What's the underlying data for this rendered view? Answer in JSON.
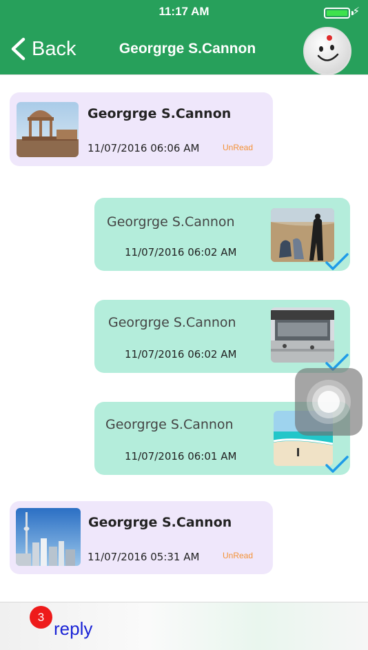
{
  "status_bar": {
    "time": "11:17 AM"
  },
  "nav": {
    "back_label": "Back",
    "title": "Georgrge S.Cannon"
  },
  "messages": [
    {
      "direction": "incoming",
      "sender": "Georgrge S.Cannon",
      "time": "11/07/2016 06:06 AM",
      "status": "UnRead",
      "thumbnail": "pavilion-photo"
    },
    {
      "direction": "outgoing",
      "sender": "Georgrge S.Cannon",
      "time": "11/07/2016 06:02 AM",
      "thumbnail": "desert-photographers-photo",
      "delivered_icon": "checkmark-icon"
    },
    {
      "direction": "outgoing",
      "sender": "Georgrge S.Cannon",
      "time": "11/07/2016 06:02 AM",
      "thumbnail": "plaza-photo",
      "delivered_icon": "checkmark-icon"
    },
    {
      "direction": "outgoing",
      "sender": "Georgrge S.Cannon",
      "time": "11/07/2016 06:01 AM",
      "thumbnail": "beach-photo",
      "delivered_icon": "checkmark-icon"
    },
    {
      "direction": "incoming",
      "sender": "Georgrge S.Cannon",
      "time": "11/07/2016 05:31 AM",
      "status": "UnRead",
      "thumbnail": "city-skyline-photo"
    }
  ],
  "bottom_bar": {
    "badge_count": "3",
    "reply_label": "reply"
  },
  "colors": {
    "header": "#27a05b",
    "incoming_bubble": "#efe7fb",
    "outgoing_bubble": "#b4eddb",
    "unread": "#f39237",
    "checkmark": "#1e9be8",
    "badge": "#ee1b1b",
    "reply_link": "#1a23d6"
  }
}
